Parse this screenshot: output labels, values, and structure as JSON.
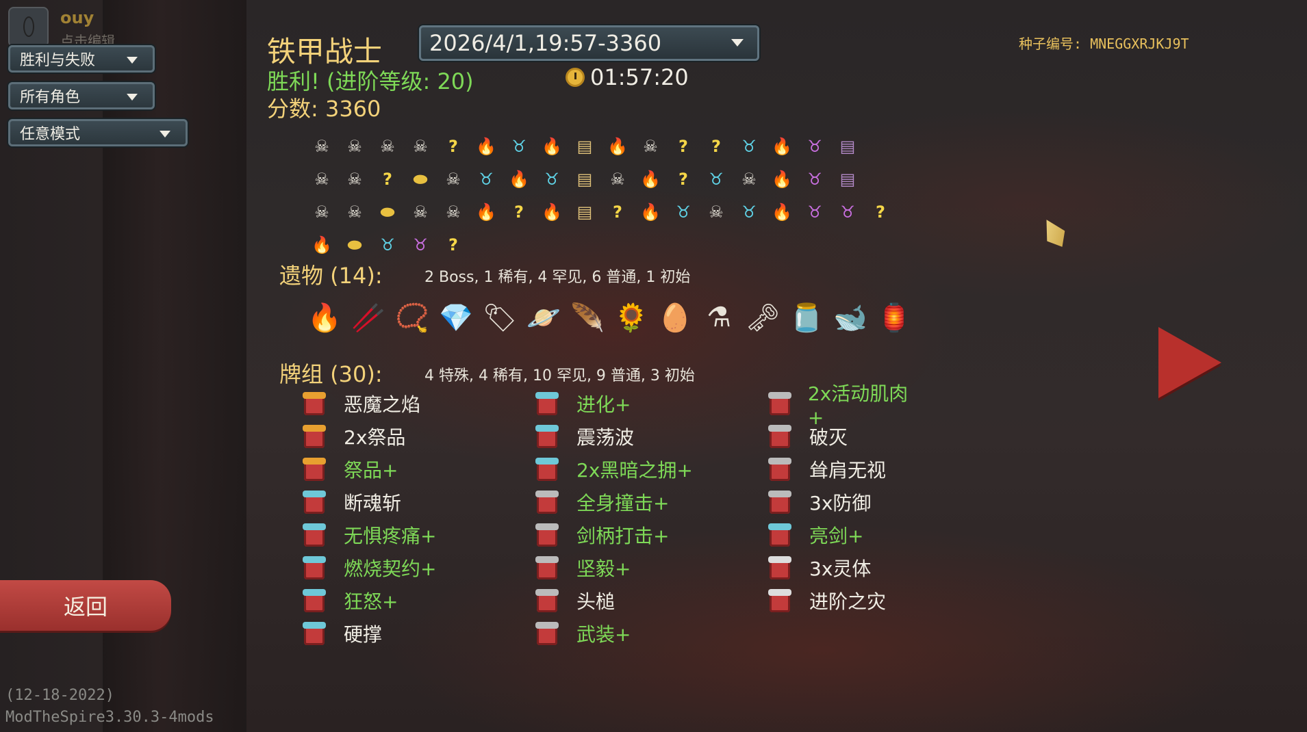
{
  "profile": {
    "name": "ouy",
    "edit_hint": "点击编辑"
  },
  "filters": [
    {
      "label": "胜利与失败"
    },
    {
      "label": "所有角色"
    },
    {
      "label": "任意模式"
    }
  ],
  "run": {
    "character": "铁甲战士",
    "selected_run": "2026/4/1,19:57-3360",
    "result": "胜利! (进阶等级: 20)",
    "score": "分数: 3360",
    "play_time": "01:57:20",
    "seed": "种子编号: MNEGGXRJKJ9T"
  },
  "path": {
    "rows": [
      [
        "m",
        "m",
        "m",
        "m",
        "q",
        "r",
        "e",
        "r",
        "t",
        "r",
        "m",
        "q",
        "q",
        "e",
        "r",
        "b",
        "c"
      ],
      [
        "m",
        "m",
        "q",
        "s",
        "m",
        "e",
        "r",
        "e",
        "t",
        "m",
        "r",
        "q",
        "e",
        "m",
        "r",
        "b",
        "c"
      ],
      [
        "m",
        "m",
        "s",
        "m",
        "m",
        "r",
        "q",
        "r",
        "t",
        "q",
        "r",
        "e",
        "m",
        "e",
        "r",
        "b",
        "b",
        "q"
      ],
      [
        "r",
        "s",
        "e",
        "b",
        "q"
      ]
    ],
    "icons": {
      "m": {
        "name": "monster-icon",
        "glyph": "☠"
      },
      "q": {
        "name": "unknown-room-icon",
        "glyph": "?"
      },
      "r": {
        "name": "rest-site-icon",
        "glyph": "🔥"
      },
      "e": {
        "name": "elite-icon",
        "glyph": "♉"
      },
      "t": {
        "name": "treasure-icon",
        "glyph": "▤"
      },
      "s": {
        "name": "shop-icon",
        "glyph": "⬬"
      },
      "b": {
        "name": "boss-icon",
        "glyph": "♉"
      },
      "c": {
        "name": "boss-chest-icon",
        "glyph": "▤"
      }
    }
  },
  "relics_section": {
    "title": "遗物 (14):",
    "summary": "2 Boss, 1 稀有, 4 罕见, 6 普通, 1 初始",
    "items": [
      {
        "name": "burning-blood-relic-icon",
        "glyph": "🔥"
      },
      {
        "name": "nunchaku-relic-icon",
        "glyph": "🥢"
      },
      {
        "name": "beads-relic-icon",
        "glyph": "📿"
      },
      {
        "name": "gem-relic-icon",
        "glyph": "💎"
      },
      {
        "name": "tag-relic-icon",
        "glyph": "🏷"
      },
      {
        "name": "orbit-relic-icon",
        "glyph": "🪐"
      },
      {
        "name": "horn-relic-icon",
        "glyph": "🪶"
      },
      {
        "name": "sunflower-relic-icon",
        "glyph": "🌻"
      },
      {
        "name": "egg-relic-icon",
        "glyph": "🥚"
      },
      {
        "name": "flask-relic-icon",
        "glyph": "⚗"
      },
      {
        "name": "key-relic-icon",
        "glyph": "🗝"
      },
      {
        "name": "jar-relic-icon",
        "glyph": "🫙"
      },
      {
        "name": "whale-relic-icon",
        "glyph": "🐋"
      },
      {
        "name": "fire-jar-relic-icon",
        "glyph": "🏮"
      }
    ]
  },
  "deck_section": {
    "title": "牌组 (30):",
    "summary": "4 特殊, 4 稀有, 10 罕见, 9 普通, 3 初始",
    "columns": [
      [
        {
          "label": "恶魔之焰",
          "upgraded": false,
          "cap": "#e8a030"
        },
        {
          "label": "2x祭品",
          "upgraded": false,
          "cap": "#e8a030"
        },
        {
          "label": "祭品+",
          "upgraded": true,
          "cap": "#e8a030"
        },
        {
          "label": "断魂斩",
          "upgraded": false,
          "cap": "#6ec8d8"
        },
        {
          "label": "无惧疼痛+",
          "upgraded": true,
          "cap": "#6ec8d8"
        },
        {
          "label": "燃烧契约+",
          "upgraded": true,
          "cap": "#6ec8d8"
        },
        {
          "label": "狂怒+",
          "upgraded": true,
          "cap": "#6ec8d8"
        },
        {
          "label": "硬撑",
          "upgraded": false,
          "cap": "#6ec8d8"
        }
      ],
      [
        {
          "label": "进化+",
          "upgraded": true,
          "cap": "#6ec8d8"
        },
        {
          "label": "震荡波",
          "upgraded": false,
          "cap": "#6ec8d8"
        },
        {
          "label": "2x黑暗之拥+",
          "upgraded": true,
          "cap": "#6ec8d8"
        },
        {
          "label": "全身撞击+",
          "upgraded": true,
          "cap": "#bbbbbb"
        },
        {
          "label": "剑柄打击+",
          "upgraded": true,
          "cap": "#bbbbbb"
        },
        {
          "label": "坚毅+",
          "upgraded": true,
          "cap": "#bbbbbb"
        },
        {
          "label": "头槌",
          "upgraded": false,
          "cap": "#bbbbbb"
        },
        {
          "label": "武装+",
          "upgraded": true,
          "cap": "#bbbbbb"
        }
      ],
      [
        {
          "label": "2x活动肌肉+",
          "upgraded": true,
          "cap": "#bbbbbb"
        },
        {
          "label": "破灭",
          "upgraded": false,
          "cap": "#bbbbbb"
        },
        {
          "label": "耸肩无视",
          "upgraded": false,
          "cap": "#bbbbbb"
        },
        {
          "label": "3x防御",
          "upgraded": false,
          "cap": "#bbbbbb"
        },
        {
          "label": "亮剑+",
          "upgraded": true,
          "cap": "#6ec8d8"
        },
        {
          "label": "3x灵体",
          "upgraded": false,
          "cap": "#dddddd"
        },
        {
          "label": "进阶之灾",
          "upgraded": false,
          "cap": "#dddddd"
        }
      ]
    ]
  },
  "back_label": "返回",
  "version": {
    "date": "(12-18-2022)",
    "mods": "ModTheSpire3.30.3-4mods"
  }
}
